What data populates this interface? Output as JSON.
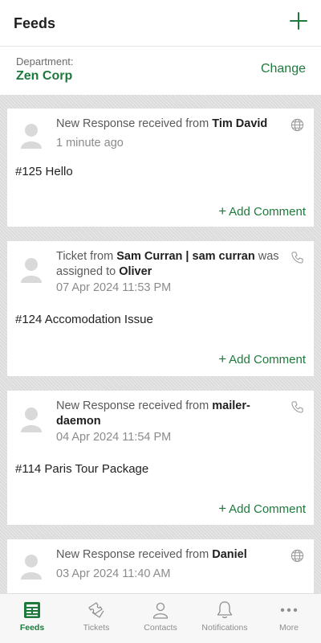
{
  "header": {
    "title": "Feeds"
  },
  "department": {
    "label": "Department:",
    "value": "Zen Corp",
    "change_label": "Change"
  },
  "feeds": [
    {
      "prefix": "New Response received from ",
      "name": "Tim David",
      "middle": "",
      "assignee": "",
      "time": "1 minute ago",
      "subject": "#125 Hello",
      "channel": "globe-icon",
      "comment_label": "Add Comment"
    },
    {
      "prefix": "Ticket from ",
      "name": "Sam Curran | sam curran",
      "middle": " was assigned to ",
      "assignee": "Oliver",
      "time": "07 Apr 2024 11:53 PM",
      "subject": "#124 Accomodation Issue",
      "channel": "phone-icon",
      "comment_label": "Add Comment"
    },
    {
      "prefix": "New Response received from ",
      "name": "mailer-daemon",
      "middle": "",
      "assignee": "",
      "time": "04 Apr 2024 11:54 PM",
      "subject": "#114 Paris Tour Package",
      "channel": "phone-icon",
      "comment_label": "Add Comment"
    },
    {
      "prefix": "New Response received from ",
      "name": "Daniel",
      "middle": "",
      "assignee": "",
      "time": "03 Apr 2024 11:40 AM",
      "subject": "",
      "channel": "globe-icon",
      "comment_label": ""
    }
  ],
  "tabs": [
    {
      "label": "Feeds",
      "icon": "feeds-icon",
      "active": true
    },
    {
      "label": "Tickets",
      "icon": "tickets-icon",
      "active": false
    },
    {
      "label": "Contacts",
      "icon": "contacts-icon",
      "active": false
    },
    {
      "label": "Notifications",
      "icon": "bell-icon",
      "active": false
    },
    {
      "label": "More",
      "icon": "more-icon",
      "active": false
    }
  ],
  "colors": {
    "accent": "#1e7a3c",
    "muted": "#8b8b8b",
    "feed_bg": "#dcdcdc"
  }
}
